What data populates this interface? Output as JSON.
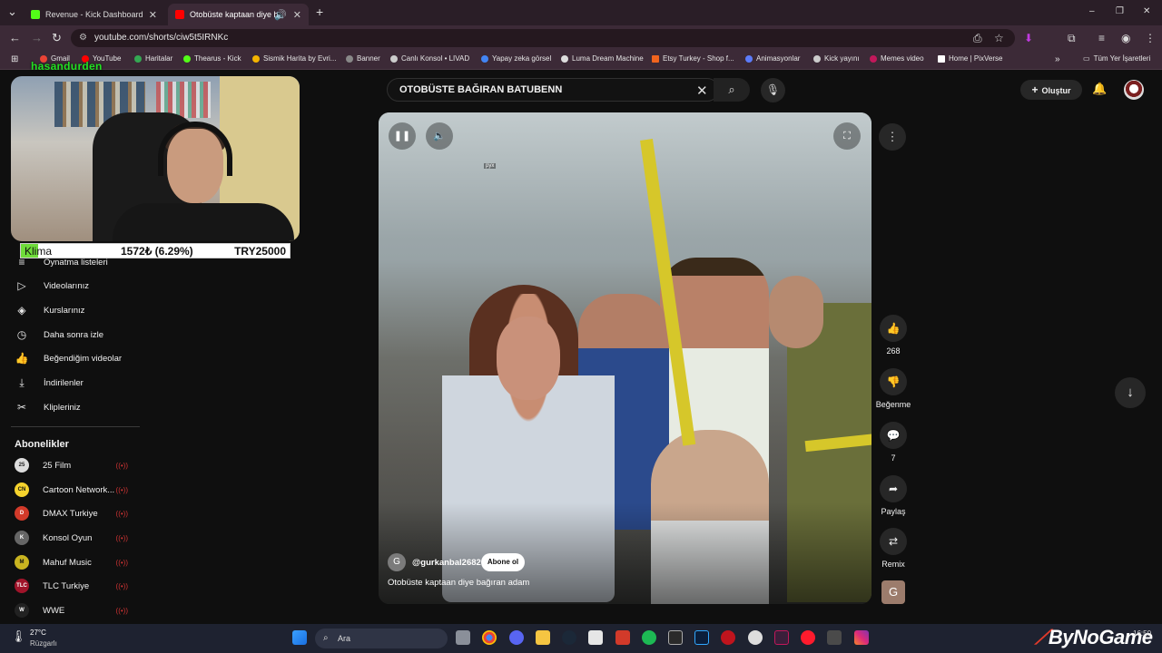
{
  "browser": {
    "tabs": [
      {
        "title": "Revenue - Kick Dashboard",
        "favicon_color": "#53fc18"
      },
      {
        "title": "Otobüste kaptaan diye ba",
        "favicon_color": "#ff0000"
      }
    ],
    "new_tab": "+",
    "window_controls": [
      "–",
      "❐",
      "✕"
    ],
    "url": "youtube.com/shorts/ciw5t5IRNKc",
    "bookmarks": [
      {
        "label": "Gmail",
        "color": "#ea4335"
      },
      {
        "label": "YouTube",
        "color": "#ff0000"
      },
      {
        "label": "Haritalar",
        "color": "#34a853"
      },
      {
        "label": "Thearus - Kick",
        "color": "#53fc18"
      },
      {
        "label": "Sismik Harita by Evri...",
        "color": "#f4b400"
      },
      {
        "label": "Banner",
        "color": "#888888"
      },
      {
        "label": "Canlı Konsol • LIVAD",
        "color": "#cccccc"
      },
      {
        "label": "Yapay zeka görsel",
        "color": "#4285f4"
      },
      {
        "label": "Luma Dream Machine",
        "color": "#dddddd"
      },
      {
        "label": "Etsy Turkey - Shop f...",
        "color": "#f1641e"
      },
      {
        "label": "Animasyonlar",
        "color": "#5c7cfa"
      },
      {
        "label": "Kick yayını",
        "color": "#cccccc"
      },
      {
        "label": "Memes video",
        "color": "#c2185b"
      },
      {
        "label": "Home | PixVerse",
        "color": "#ffffff"
      }
    ],
    "all_bookmarks": "Tüm Yer İşaretleri"
  },
  "webcam": {
    "streamer_name": "hasandurden",
    "goal": {
      "name": "Klima",
      "current": "1572₺ (6.29%)",
      "target": "TRY25000",
      "progress": 0.0629
    }
  },
  "youtube": {
    "search_value": "OTOBÜSTE BAĞIRAN BATUBENN",
    "create_label": "Oluştur",
    "sidebar_items": [
      {
        "label": "Oynatma listeleri",
        "icon": "playlist-icon"
      },
      {
        "label": "Videolarınız",
        "icon": "video-icon"
      },
      {
        "label": "Kurslarınız",
        "icon": "course-icon"
      },
      {
        "label": "Daha sonra izle",
        "icon": "clock-icon"
      },
      {
        "label": "Beğendiğim videolar",
        "icon": "thumbs-up-icon"
      },
      {
        "label": "İndirilenler",
        "icon": "download-icon"
      },
      {
        "label": "Klipleriniz",
        "icon": "scissors-icon"
      }
    ],
    "subscriptions_heading": "Abonelikler",
    "subscriptions": [
      {
        "name": "25 Film",
        "avatar_color": "#dddddd"
      },
      {
        "name": "Cartoon Network...",
        "avatar_color": "#f5d32d"
      },
      {
        "name": "DMAX Turkiye",
        "avatar_color": "#d23a2a"
      },
      {
        "name": "Konsol Oyun",
        "avatar_color": "#666666"
      },
      {
        "name": "Mahuf Music",
        "avatar_color": "#c9b420"
      },
      {
        "name": "TLC Turkiye",
        "avatar_color": "#a0142a"
      },
      {
        "name": "WWE",
        "avatar_color": "#222222"
      }
    ],
    "short": {
      "watermark": "pyx",
      "channel_initial": "G",
      "channel_handle": "@gurkanbal2682",
      "subscribe_label": "Abone ol",
      "title": "Otobüste kaptaan diye bağıran adam",
      "likes": "268",
      "dislike_label": "Beğenme",
      "comments": "7",
      "share_label": "Paylaş",
      "remix_label": "Remix",
      "sound_initial": "G"
    }
  },
  "taskbar": {
    "weather_temp": "27°C",
    "weather_desc": "Rüzgarlı",
    "search_placeholder": "Ara",
    "brand": "ByNoGame",
    "clock": "16:50"
  }
}
